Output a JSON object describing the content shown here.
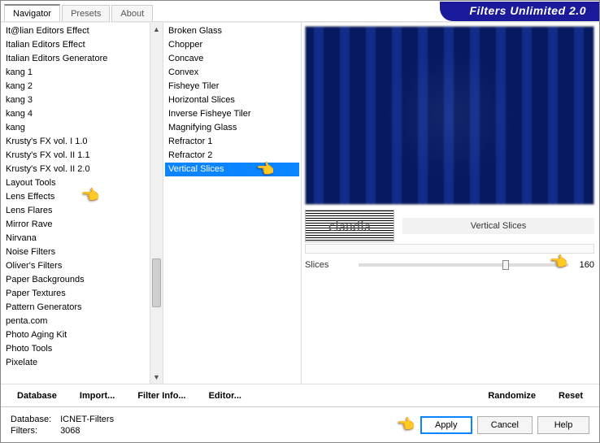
{
  "brand": "Filters Unlimited 2.0",
  "tabs": {
    "navigator": "Navigator",
    "presets": "Presets",
    "about": "About"
  },
  "categories": [
    "It@lian Editors Effect",
    "Italian Editors Effect",
    "Italian Editors Generatore",
    "kang 1",
    "kang 2",
    "kang 3",
    "kang 4",
    "kang",
    "Krusty's FX vol. I 1.0",
    "Krusty's FX vol. II 1.1",
    "Krusty's FX vol. II 2.0",
    "Layout Tools",
    "Lens Effects",
    "Lens Flares",
    "Mirror Rave",
    "Nirvana",
    "Noise Filters",
    "Oliver's Filters",
    "Paper Backgrounds",
    "Paper Textures",
    "Pattern Generators",
    "penta.com",
    "Photo Aging Kit",
    "Photo Tools",
    "Pixelate"
  ],
  "category_selected": "Lens Effects",
  "filters": [
    "Broken Glass",
    "Chopper",
    "Concave",
    "Convex",
    "Fisheye Tiler",
    "Horizontal Slices",
    "Inverse Fisheye Tiler",
    "Magnifying Glass",
    "Refractor 1",
    "Refractor 2",
    "Vertical Slices"
  ],
  "filter_selected": "Vertical Slices",
  "logo_label": "claudia",
  "current_filter_title": "Vertical Slices",
  "sliders": {
    "slices": {
      "label": "Slices",
      "value": "160",
      "pos_pct": 70
    }
  },
  "toolbar": {
    "database": "Database",
    "import": "Import...",
    "filterinfo": "Filter Info...",
    "editor": "Editor...",
    "randomize": "Randomize",
    "reset": "Reset"
  },
  "dbinfo": {
    "db_label": "Database:",
    "db_value": "ICNET-Filters",
    "filters_label": "Filters:",
    "filters_value": "3068"
  },
  "buttons": {
    "apply": "Apply",
    "cancel": "Cancel",
    "help": "Help"
  }
}
